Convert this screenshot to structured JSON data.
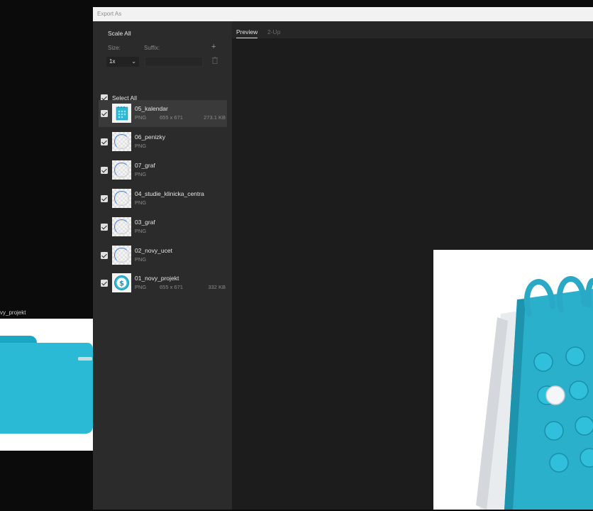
{
  "background": {
    "artboard_label": "vy_projekt"
  },
  "dialog": {
    "title": "Export As",
    "scale_all_label": "Scale All",
    "size_label": "Size:",
    "suffix_label": "Suffix:",
    "add_button": "+",
    "scale_value": "1x",
    "suffix_value": "",
    "select_all_label": "Select All",
    "tabs": [
      {
        "label": "Preview",
        "active": true
      },
      {
        "label": "2-Up",
        "active": false
      }
    ],
    "items": [
      {
        "name": "05_kalendar",
        "format": "PNG",
        "dims": "655 x 671",
        "size": "273.1 KB",
        "selected": true,
        "thumb": "calendar-icon"
      },
      {
        "name": "06_penizky",
        "format": "PNG",
        "dims": "",
        "size": "",
        "selected": false,
        "thumb": "loading-icon"
      },
      {
        "name": "07_graf",
        "format": "PNG",
        "dims": "",
        "size": "",
        "selected": false,
        "thumb": "loading-icon"
      },
      {
        "name": "04_studie_klinicka_centra",
        "format": "PNG",
        "dims": "",
        "size": "",
        "selected": false,
        "thumb": "loading-icon"
      },
      {
        "name": "03_graf",
        "format": "PNG",
        "dims": "",
        "size": "",
        "selected": false,
        "thumb": "loading-icon"
      },
      {
        "name": "02_novy_ucet",
        "format": "PNG",
        "dims": "",
        "size": "",
        "selected": false,
        "thumb": "loading-icon"
      },
      {
        "name": "01_novy_projekt",
        "format": "PNG",
        "dims": "655 x 671",
        "size": "332 KB",
        "selected": false,
        "thumb": "dollar-coin-icon"
      }
    ]
  },
  "colors": {
    "accent": "#2bbad6",
    "panel": "#2b2b2b",
    "preview_bg": "#1c1c1c"
  }
}
